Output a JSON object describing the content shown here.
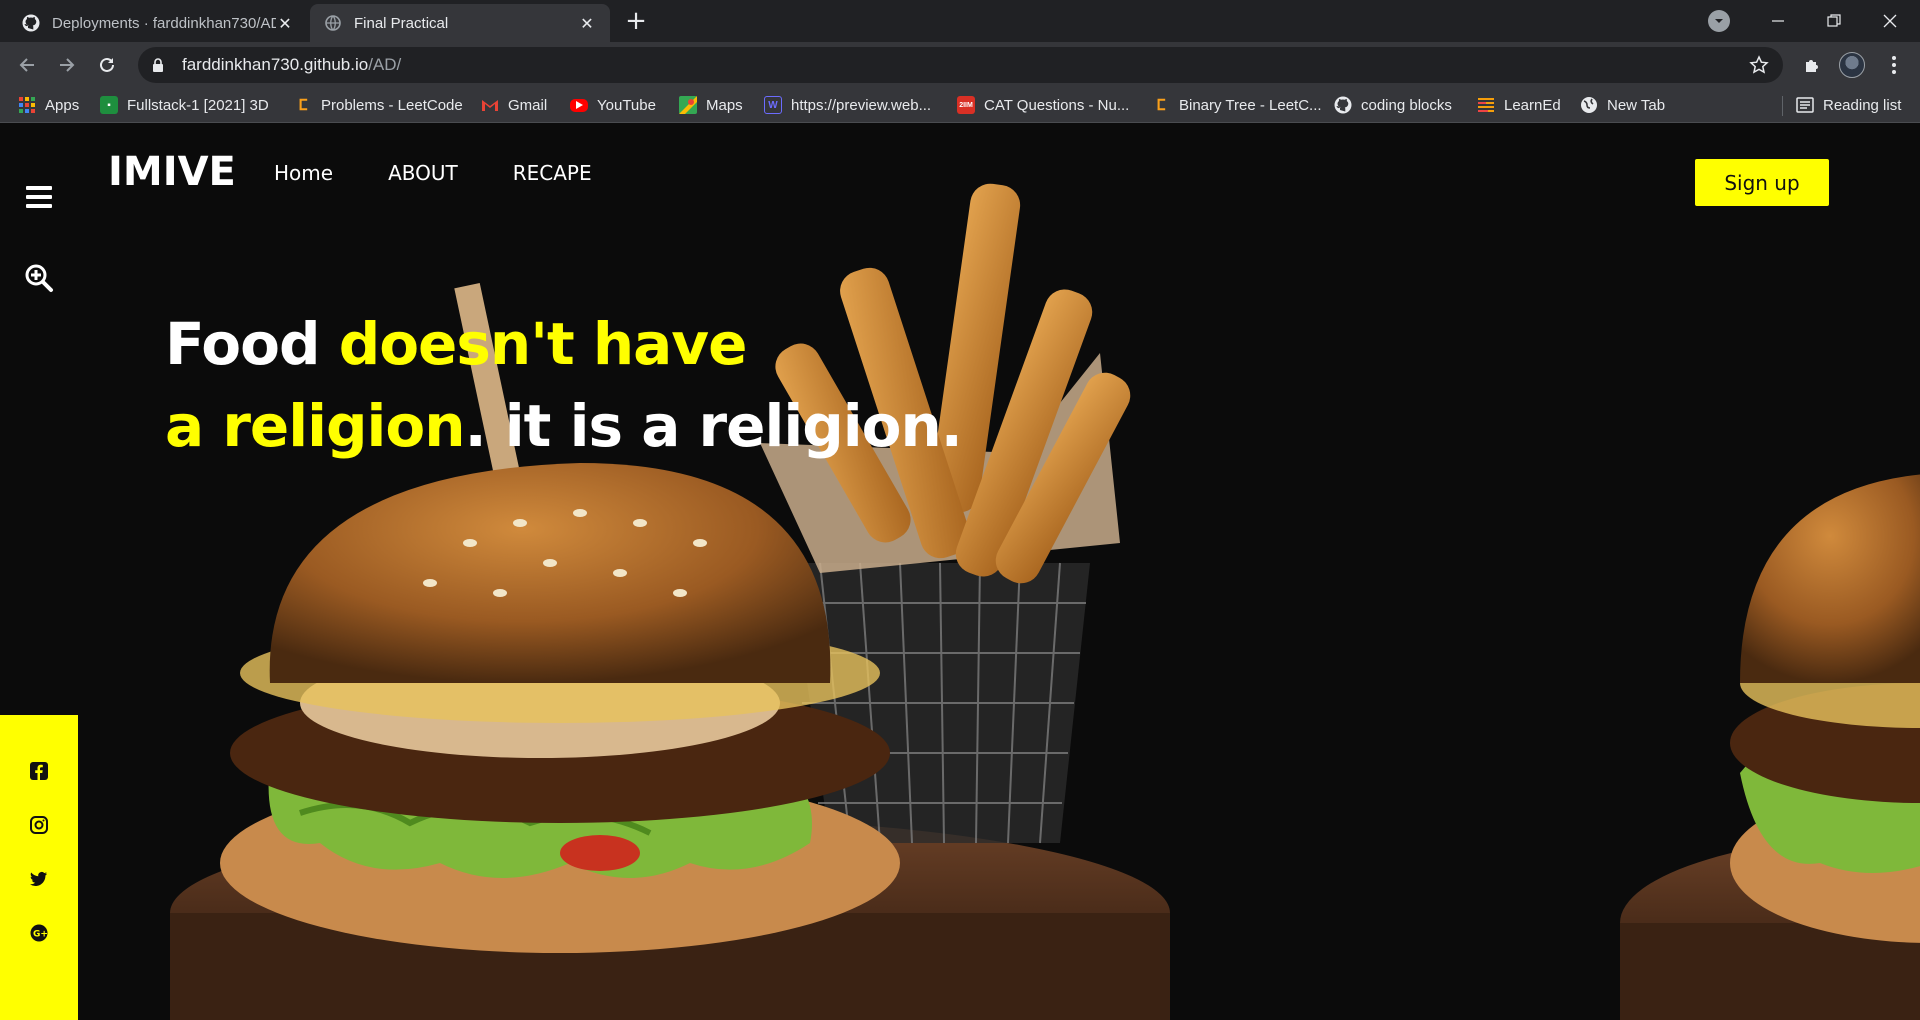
{
  "browser": {
    "tabs": [
      {
        "title": "Deployments · farddinkhan730/AD",
        "active": false,
        "icon": "github-icon"
      },
      {
        "title": "Final Practical",
        "active": true,
        "icon": "globe-icon"
      }
    ],
    "url_host": "farddinkhan730.github.io",
    "url_path": "/AD/",
    "bookmarks": [
      {
        "label": "Apps",
        "icon": "apps-grid-icon"
      },
      {
        "label": "Fullstack-1 [2021] 3D",
        "icon": "classroom-icon"
      },
      {
        "label": "Problems - LeetCode",
        "icon": "leetcode-icon"
      },
      {
        "label": "Gmail",
        "icon": "gmail-icon"
      },
      {
        "label": "YouTube",
        "icon": "youtube-icon"
      },
      {
        "label": "Maps",
        "icon": "maps-icon"
      },
      {
        "label": "https://preview.web...",
        "icon": "w-icon"
      },
      {
        "label": "CAT Questions - Nu...",
        "icon": "cat-icon"
      },
      {
        "label": "Binary Tree - LeetC...",
        "icon": "leetcode-icon"
      },
      {
        "label": "coding blocks",
        "icon": "github-icon"
      },
      {
        "label": "LearnEd",
        "icon": "learned-icon"
      },
      {
        "label": "New Tab",
        "icon": "globe-icon"
      }
    ],
    "reading_list": "Reading list"
  },
  "site": {
    "brand": "IMIVE",
    "nav": [
      "Home",
      "ABOUT",
      "RECAPE"
    ],
    "signup": "Sign up",
    "headline": {
      "part1": "Food ",
      "part2": "doesn't have",
      "part3": "a religion",
      "part4": ". it is a religion."
    },
    "social_icons": [
      "facebook-icon",
      "instagram-icon",
      "twitter-icon",
      "google-plus-icon"
    ],
    "accent": "#ffff00"
  }
}
